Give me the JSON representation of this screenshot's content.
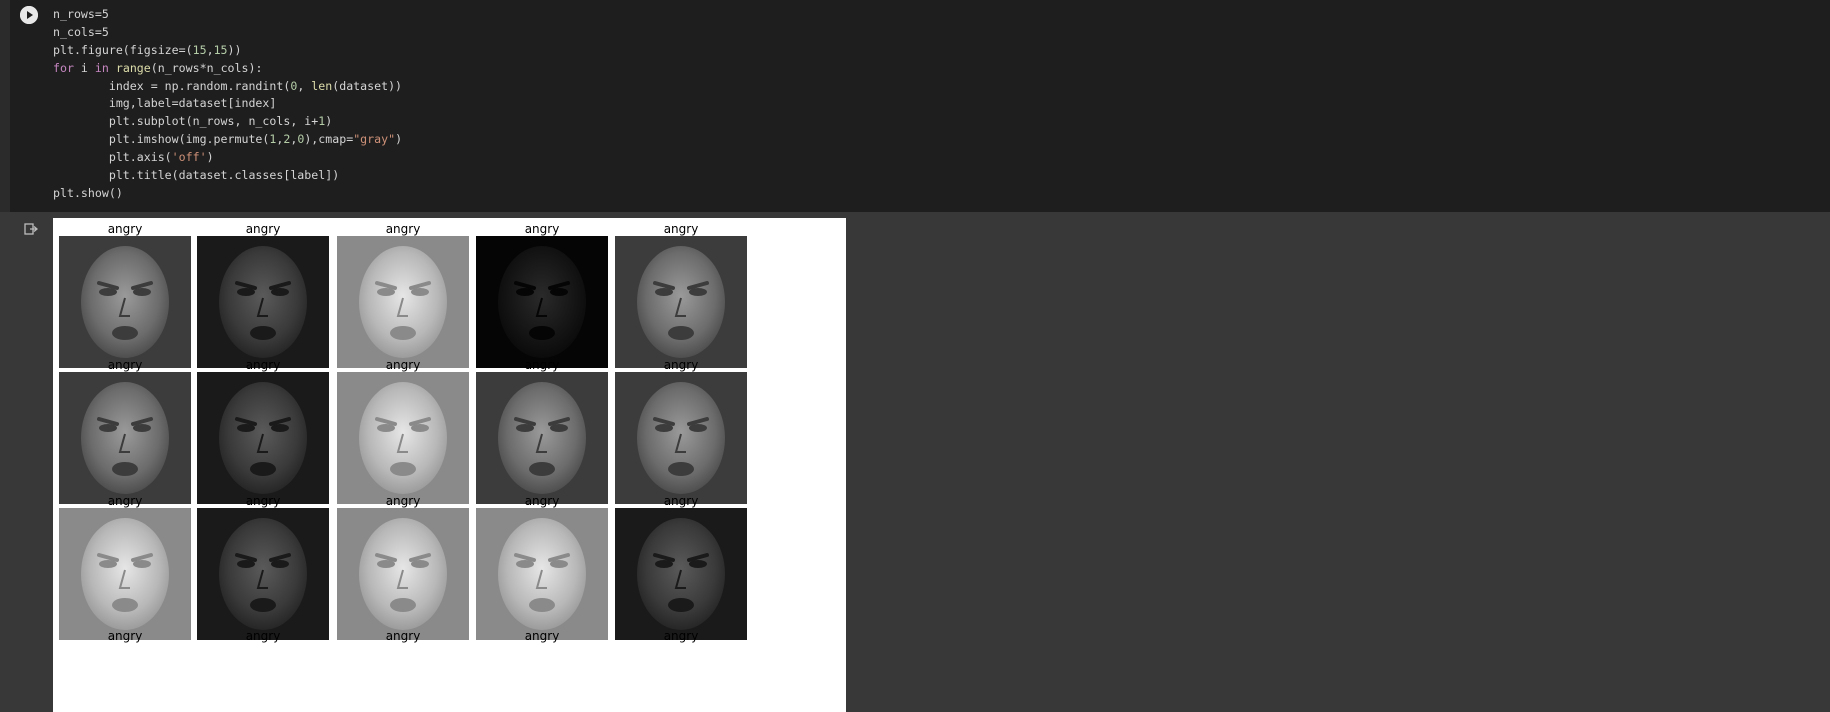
{
  "code_lines": [
    [
      {
        "t": "n_rows=5"
      }
    ],
    [
      {
        "t": "n_cols=5"
      }
    ],
    [
      {
        "t": "plt.figure(figsize=("
      },
      {
        "t": "15",
        "c": "num"
      },
      {
        "t": ","
      },
      {
        "t": "15",
        "c": "num"
      },
      {
        "t": "))"
      }
    ],
    [
      {
        "t": "for",
        "c": "kw"
      },
      {
        "t": " i "
      },
      {
        "t": "in",
        "c": "kw"
      },
      {
        "t": " "
      },
      {
        "t": "range",
        "c": "bi"
      },
      {
        "t": "(n_rows*n_cols):"
      }
    ],
    [
      {
        "t": "        index = np.random.randint("
      },
      {
        "t": "0",
        "c": "num"
      },
      {
        "t": ", "
      },
      {
        "t": "len",
        "c": "bi"
      },
      {
        "t": "(dataset))"
      }
    ],
    [
      {
        "t": "        img,label=dataset[index]"
      }
    ],
    [
      {
        "t": "        plt.subplot(n_rows, n_cols, i+"
      },
      {
        "t": "1",
        "c": "num"
      },
      {
        "t": ")"
      }
    ],
    [
      {
        "t": "        plt.imshow(img.permute("
      },
      {
        "t": "1",
        "c": "num"
      },
      {
        "t": ","
      },
      {
        "t": "2",
        "c": "num"
      },
      {
        "t": ","
      },
      {
        "t": "0",
        "c": "num"
      },
      {
        "t": "),cmap="
      },
      {
        "t": "\"gray\"",
        "c": "str"
      },
      {
        "t": ")"
      }
    ],
    [
      {
        "t": "        plt.axis("
      },
      {
        "t": "'off'",
        "c": "str"
      },
      {
        "t": ")"
      }
    ],
    [
      {
        "t": "        plt.title(dataset.classes[label])"
      }
    ],
    [
      {
        "t": "plt.show()"
      }
    ]
  ],
  "subplots": [
    {
      "title": "angry",
      "tone": "mid"
    },
    {
      "title": "angry",
      "tone": "dark"
    },
    {
      "title": "angry",
      "tone": "light"
    },
    {
      "title": "angry",
      "tone": "black"
    },
    {
      "title": "angry",
      "tone": "mid"
    },
    {
      "title": "angry",
      "tone": "mid"
    },
    {
      "title": "angry",
      "tone": "dark"
    },
    {
      "title": "angry",
      "tone": "light"
    },
    {
      "title": "angry",
      "tone": "mid"
    },
    {
      "title": "angry",
      "tone": "mid"
    },
    {
      "title": "angry",
      "tone": "light"
    },
    {
      "title": "angry",
      "tone": "dark"
    },
    {
      "title": "angry",
      "tone": "light"
    },
    {
      "title": "angry",
      "tone": "light"
    },
    {
      "title": "angry",
      "tone": "dark"
    },
    {
      "title": "angry",
      "tone": "mid"
    },
    {
      "title": "angry",
      "tone": "mid"
    },
    {
      "title": "angry",
      "tone": "mid"
    },
    {
      "title": "angry",
      "tone": "mid"
    },
    {
      "title": "angry",
      "tone": "mid"
    }
  ],
  "colors": {
    "code_bg": "#1e1e1e",
    "output_bg": "#383838",
    "figure_bg": "#ffffff"
  },
  "icons": {
    "run": "run-cell-icon",
    "output": "output-icon"
  }
}
